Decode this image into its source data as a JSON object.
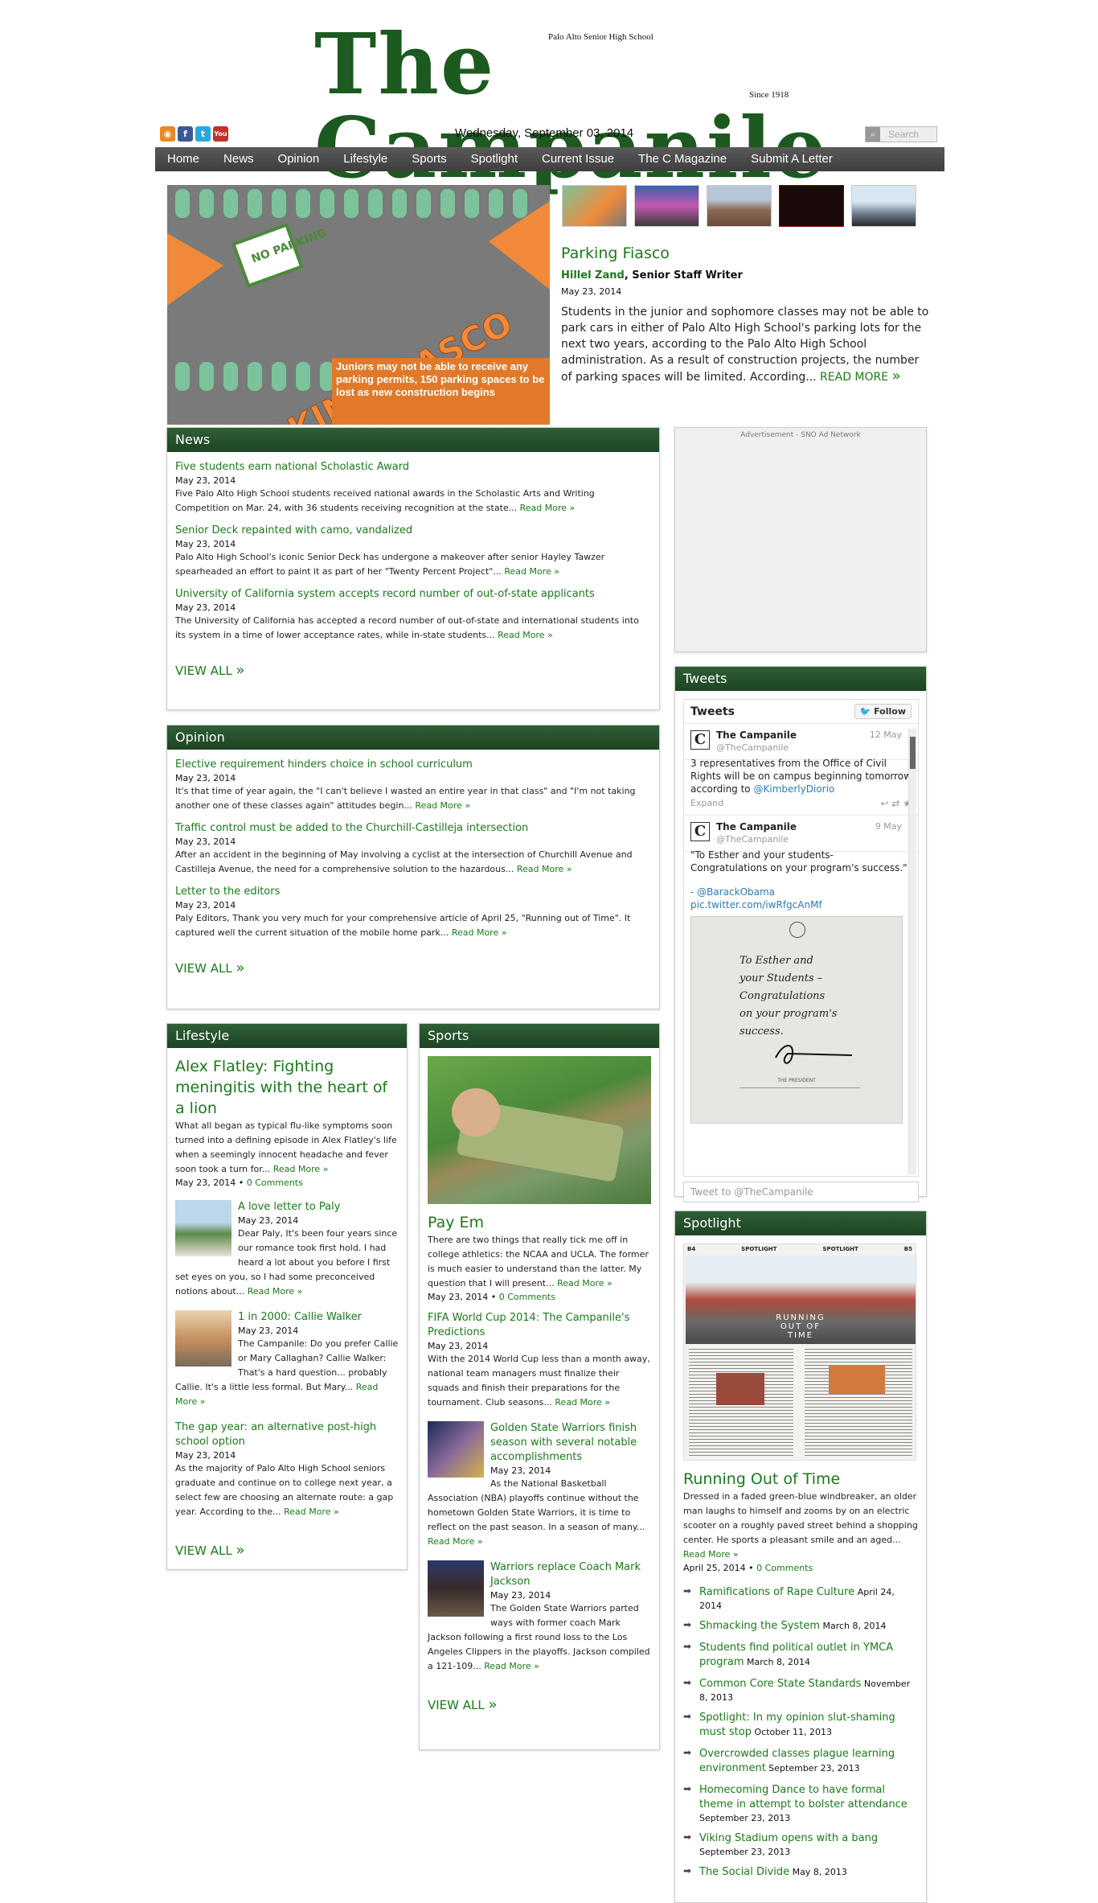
{
  "masthead": {
    "title": "The Campanile",
    "school": "Palo Alto Senior High School",
    "since": "Since 1918"
  },
  "social": [
    {
      "icon": "rss-icon",
      "glyph": "◉"
    },
    {
      "icon": "facebook-icon",
      "glyph": "f"
    },
    {
      "icon": "twitter-icon",
      "glyph": "t"
    },
    {
      "icon": "youtube-icon",
      "glyph": "You"
    }
  ],
  "date": "Wednesday, September 03, 2014",
  "search": {
    "placeholder": "Search"
  },
  "nav": [
    "Home",
    "News",
    "Opinion",
    "Lifestyle",
    "Sports",
    "Spotlight",
    "Current Issue",
    "The C Magazine",
    "Submit A Letter"
  ],
  "featured": {
    "image_title": "PARKING FIASCO",
    "sign": "NO PARKING",
    "image_caption": "Juniors may not be able to receive any parking permits, 150 parking spaces to be lost as new construction begins",
    "title": "Parking Fiasco",
    "author": "Hillel Zand",
    "role": ", Senior Staff Writer",
    "date": "May 23, 2014",
    "text": "Students in the junior and sophomore classes may not be able to park cars in either of Palo Alto High School's parking lots for the next two years, according to the Palo Alto High School administration. As a result of construction projects, the number of parking spaces will be limited. According...",
    "more": "READ MORE",
    "chevrons": "»"
  },
  "news": {
    "header": "News",
    "articles": [
      {
        "title": "Five students earn national Scholastic Award",
        "date": "May 23, 2014",
        "text": "Five Palo Alto High School students received national awards in the Scholastic Arts and Writing Competition on Mar. 24, with 36 students receiving recognition at the state...",
        "more": "Read More »"
      },
      {
        "title": "Senior Deck repainted with camo, vandalized",
        "date": "May 23, 2014",
        "text": "Palo Alto High School's iconic Senior Deck has undergone a makeover after senior Hayley Tawzer spearheaded an effort to paint it as part of her \"Twenty Percent Project\"...",
        "more": "Read More »"
      },
      {
        "title": "University of California system accepts record number of out-of-state applicants",
        "date": "May 23, 2014",
        "text": "The University of California has accepted a record number of out-of-state and international students into its system in a time of lower acceptance rates, while in-state students...",
        "more": "Read More »"
      }
    ],
    "view_all": "VIEW ALL"
  },
  "opinion": {
    "header": "Opinion",
    "articles": [
      {
        "title": "Elective requirement hinders choice in school curriculum",
        "date": "May 23, 2014",
        "text": "It's that time of year again, the \"I can't believe I wasted an entire year in that class\" and \"I'm not taking another one of these classes again\" attitudes begin...",
        "more": "Read More »"
      },
      {
        "title": "Traffic control must be added to the Churchill-Castilleja intersection",
        "date": "May 23, 2014",
        "text": "After an accident in the beginning of May involving a cyclist at the intersection of Churchill Avenue and Castilleja Avenue, the need for a comprehensive solution to the hazardous...",
        "more": "Read More »"
      },
      {
        "title": "Letter to the editors",
        "date": "May 23, 2014",
        "text": "Paly Editors, Thank you very much for your comprehensive article of April 25, \"Running out of Time\". It captured well the current situation of the mobile home park...",
        "more": "Read More »"
      }
    ],
    "view_all": "VIEW ALL"
  },
  "ad": {
    "label": "Advertisement - SNO Ad Network"
  },
  "lifestyle": {
    "header": "Lifestyle",
    "lead": {
      "title": "Alex Flatley: Fighting meningitis with the heart of a lion",
      "text": "What all began as typical flu-like symptoms soon turned into a defining episode in Alex Flatley's life when a seemingly innocent headache and fever soon took a turn for...",
      "more": "Read More »",
      "date": "May 23, 2014",
      "comments": "0 Comments"
    },
    "articles": [
      {
        "title": "A love letter to Paly",
        "date": "May 23, 2014",
        "text": "Dear Paly, It's been four years since our romance took first hold. I had heard a lot about you before I first set eyes on you, so I had some preconceived notions about...",
        "more": "Read More »"
      },
      {
        "title": "1 in 2000: Callie Walker",
        "date": "May 23, 2014",
        "text": "The Campanile: Do you prefer Callie or Mary Callaghan? Callie Walker: That's a hard question... probably Callie. It's a little less formal. But Mary...",
        "more": "Read More »"
      },
      {
        "title": "The gap year: an alternative post-high school option",
        "date": "May 23, 2014",
        "text": "As the majority of Palo Alto High School seniors graduate and continue on to college next year, a select few are choosing an alternate route: a gap year. According to the...",
        "more": "Read More »"
      }
    ],
    "view_all": "VIEW ALL"
  },
  "sports": {
    "header": "Sports",
    "lead": {
      "title": "Pay Em",
      "text": "There are two things that really tick me off in college athletics: the NCAA and UCLA. The former is much easier to understand than the latter. My question that I will present...",
      "more": "Read More »",
      "date": "May 23, 2014",
      "comments": "0 Comments"
    },
    "articles": [
      {
        "title": "FIFA World Cup 2014: The Campanile's Predictions",
        "date": "May 23, 2014",
        "text": "With the 2014 World Cup less than a month away, national team managers must finalize their squads and finish their preparations for the tournament. Club seasons...",
        "more": "Read More »"
      },
      {
        "title": "Golden State Warriors finish season with several notable accomplishments",
        "date": "May 23, 2014",
        "text": "As the National Basketball Association (NBA) playoffs continue without the hometown Golden State Warriors, it is time to reflect on the past season. In a season of many...",
        "more": "Read More »"
      },
      {
        "title": "Warriors replace Coach Mark Jackson",
        "date": "May 23, 2014",
        "text": "The Golden State Warriors parted ways with former coach Mark Jackson following a first round loss to the Los Angeles Clippers in the playoffs. Jackson compiled a 121-109...",
        "more": "Read More »"
      }
    ],
    "view_all": "VIEW ALL"
  },
  "tweets": {
    "header": "Tweets",
    "widget_title": "Tweets",
    "follow": "Follow",
    "items": [
      {
        "name": "The Campanile",
        "handle": "@TheCampanile",
        "time": "12 May",
        "text": "3 representatives from the Office of Civil Rights will be on campus beginning tomorrow according to",
        "link": "@KimberlyDiorio",
        "expand": "Expand"
      },
      {
        "name": "The Campanile",
        "handle": "@TheCampanile",
        "time": "9 May",
        "text": "\"To Esther and your students- Congratulations on your program's success.\"",
        "link": "- @BarackObama",
        "link2": "pic.twitter.com/iwRfgcAnMf",
        "note_lines": [
          "To Esther and",
          "your Students –",
          "Congratulations",
          "on your program's",
          "success."
        ],
        "seal_caption": "THE PRESIDENT"
      }
    ],
    "compose": "Tweet to @TheCampanile"
  },
  "spotlight": {
    "header": "Spotlight",
    "page_labels": [
      "B4",
      "SPOTLIGHT",
      "SPOTLIGHT",
      "B5"
    ],
    "image_title": "RUNNING OUT OF TIME",
    "title": "Running Out of Time",
    "text": "Dressed in a faded green-blue windbreaker, an older man laughs to himself and zooms by on an electric scooter on a roughly paved street behind a shopping center. He sports a pleasant smile and an aged...",
    "more": "Read More »",
    "date": "April 25, 2014",
    "comments": "0 Comments",
    "list": [
      {
        "title": "Ramifications of Rape Culture",
        "date": "April 24, 2014"
      },
      {
        "title": "Shmacking the System",
        "date": "March 8, 2014"
      },
      {
        "title": "Students find political outlet in YMCA program",
        "date": "March 8, 2014"
      },
      {
        "title": "Common Core State Standards",
        "date": "November 8, 2013"
      },
      {
        "title": "Spotlight: In my opinion slut-shaming must stop",
        "date": "October 11, 2013"
      },
      {
        "title": "Overcrowded classes plague learning environment",
        "date": "September 23, 2013"
      },
      {
        "title": "Homecoming Dance to have formal theme in attempt to bolster attendance",
        "date": "September 23, 2013"
      },
      {
        "title": "Viking Stadium opens with a bang",
        "date": "September 23, 2013"
      },
      {
        "title": "The Social Divide",
        "date": "May 8, 2013"
      }
    ]
  },
  "colors": {
    "brand_green": "#1c5a20",
    "link_green": "#1a7a1a",
    "header_green": "#2f5f36",
    "nav_gray": "#4a4a4a"
  }
}
